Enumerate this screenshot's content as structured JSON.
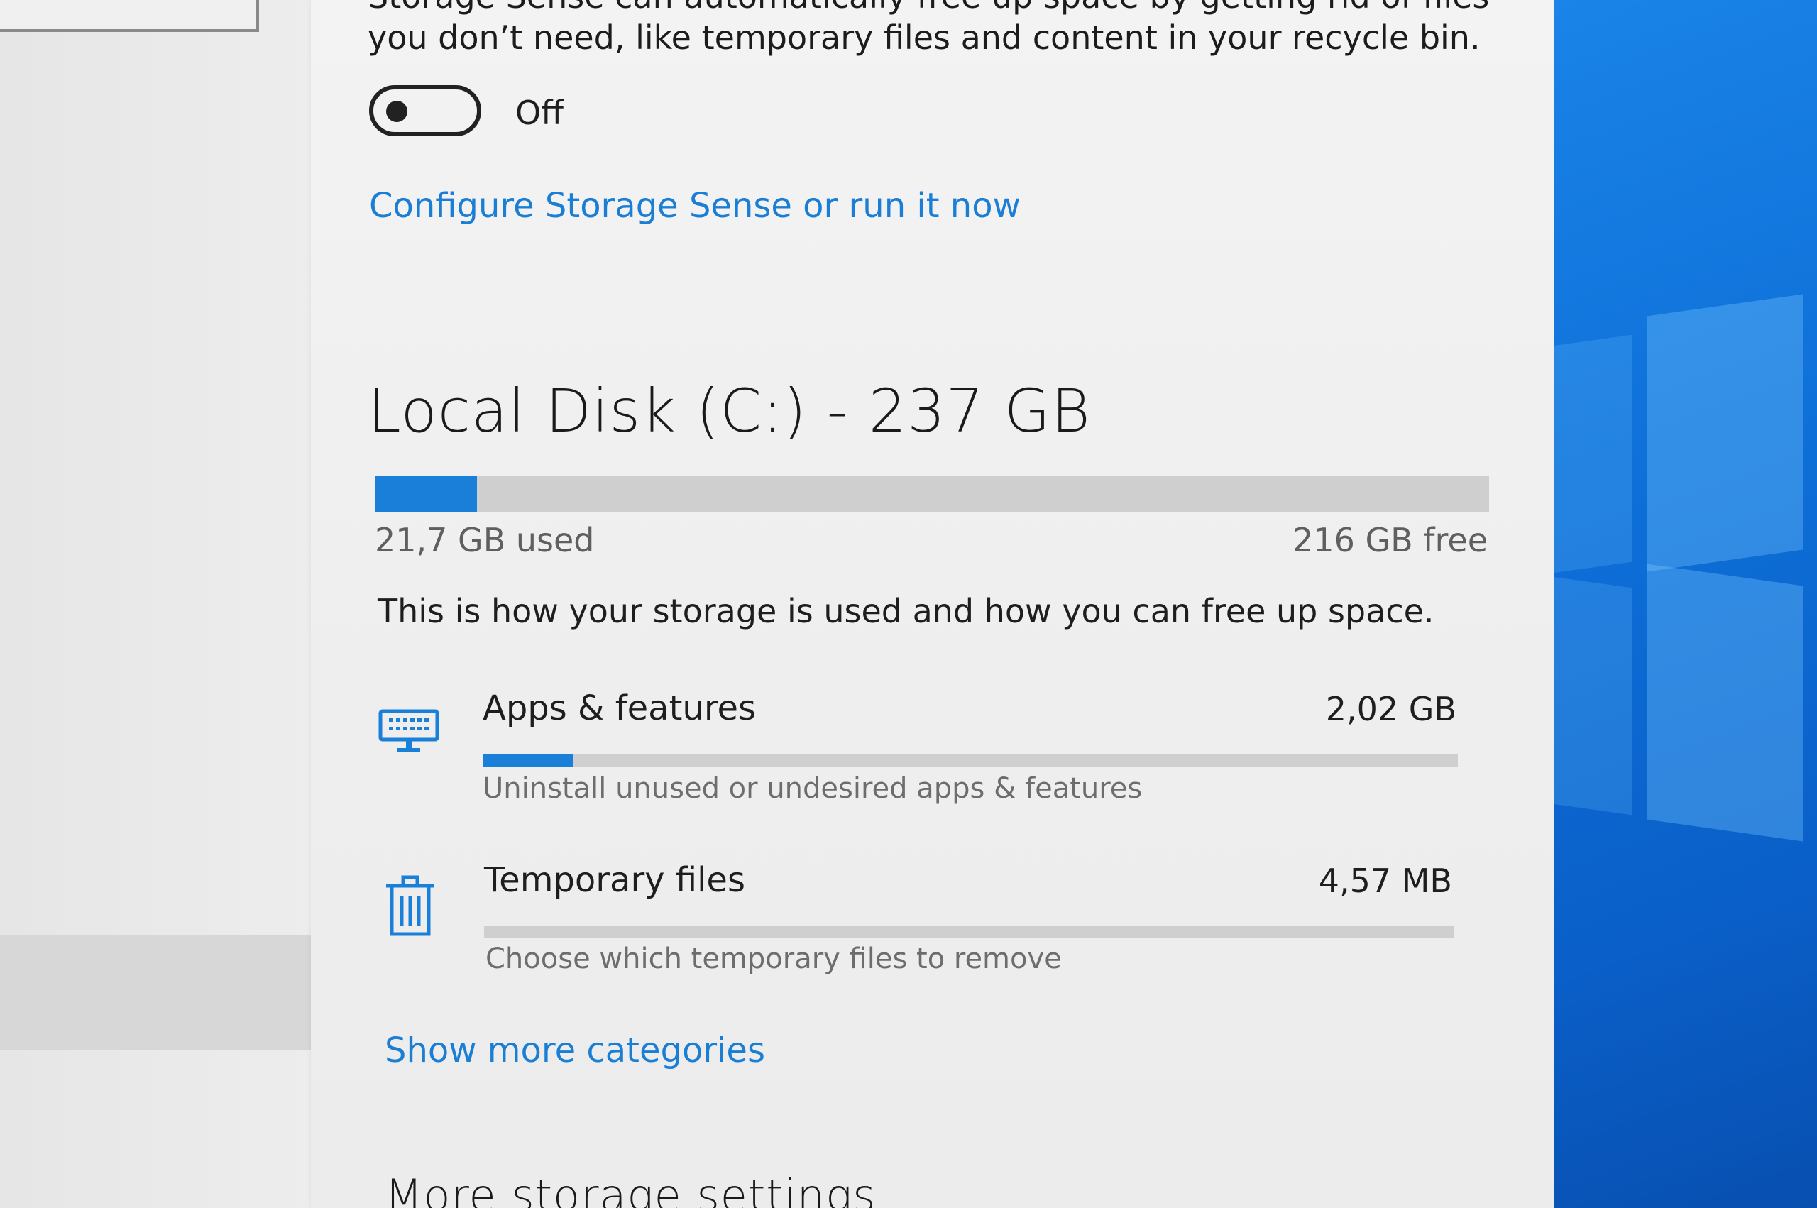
{
  "storage_sense": {
    "description_line1": "Storage Sense can automatically free up space by getting rid of files",
    "description_line2": "you don’t need, like temporary files and content in your recycle bin.",
    "toggle_state": "Off",
    "toggle_on": false,
    "configure_link": "Configure Storage Sense or run it now"
  },
  "disk": {
    "title": "Local Disk (C:) - 237 GB",
    "used_label": "21,7 GB used",
    "free_label": "216 GB free",
    "used_fraction": 0.0916,
    "accent_color": "#1a7fd8"
  },
  "usage_intro": "This is how your storage is used and how you can free up space.",
  "categories": [
    {
      "icon": "keyboard-icon",
      "title": "Apps & features",
      "size": "2,02 GB",
      "subtitle": "Uninstall unused or undesired apps & features",
      "fraction": 0.093
    },
    {
      "icon": "trash-icon",
      "title": "Temporary files",
      "size": "4,57 MB",
      "subtitle": "Choose which temporary files to remove",
      "fraction": 0.0
    }
  ],
  "show_more_link": "Show more categories",
  "more_settings_heading": "More storage settings"
}
